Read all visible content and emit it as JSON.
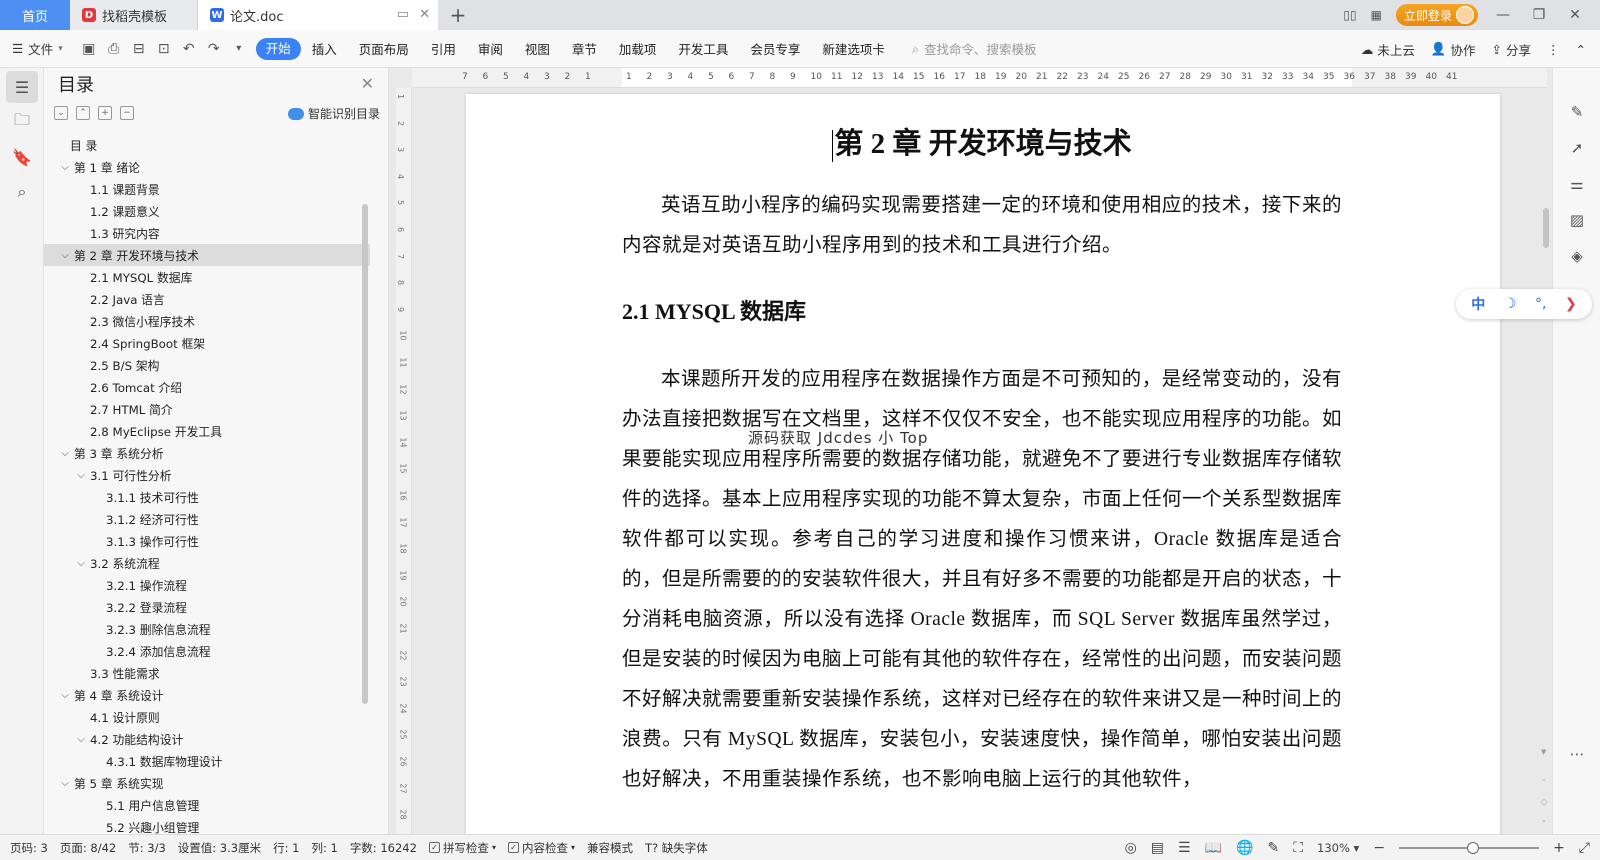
{
  "tabs": {
    "home": "首页",
    "template": "找稻壳模板",
    "doc": "论文.doc",
    "add": "+"
  },
  "titlebar": {
    "login": "立即登录"
  },
  "ribbon": {
    "file": "文件",
    "menus": [
      "开始",
      "插入",
      "页面布局",
      "引用",
      "审阅",
      "视图",
      "章节",
      "加载项",
      "开发工具",
      "会员专享",
      "新建选项卡"
    ],
    "active_menu": "开始",
    "search_placeholder": "查找命令、搜索模板",
    "cloud": "未上云",
    "collab": "协作",
    "share": "分享"
  },
  "outline": {
    "title": "目录",
    "smart": "智能识别目录",
    "items": [
      {
        "label": "目  录",
        "level": 0,
        "chev": ""
      },
      {
        "label": "第 1 章  绪论",
        "level": 1,
        "chev": "v"
      },
      {
        "label": "1.1  课题背景",
        "level": 2,
        "chev": ""
      },
      {
        "label": "1.2  课题意义",
        "level": 2,
        "chev": ""
      },
      {
        "label": "1.3  研究内容",
        "level": 2,
        "chev": ""
      },
      {
        "label": "第 2 章  开发环境与技术",
        "level": 1,
        "chev": "v",
        "active": true
      },
      {
        "label": "2.1 MYSQL 数据库",
        "level": 2,
        "chev": ""
      },
      {
        "label": "2.2 Java 语言",
        "level": 2,
        "chev": ""
      },
      {
        "label": "2.3  微信小程序技术",
        "level": 2,
        "chev": ""
      },
      {
        "label": "2.4 SpringBoot 框架",
        "level": 2,
        "chev": ""
      },
      {
        "label": "2.5 B/S 架构",
        "level": 2,
        "chev": ""
      },
      {
        "label": "2.6 Tomcat  介绍",
        "level": 2,
        "chev": ""
      },
      {
        "label": "2.7 HTML 简介",
        "level": 2,
        "chev": ""
      },
      {
        "label": "2.8 MyEclipse 开发工具",
        "level": 2,
        "chev": ""
      },
      {
        "label": "第 3 章  系统分析",
        "level": 1,
        "chev": "v"
      },
      {
        "label": "3.1  可行性分析",
        "level": "2c",
        "chev": "v"
      },
      {
        "label": "3.1.1  技术可行性",
        "level": 3,
        "chev": ""
      },
      {
        "label": "3.1.2  经济可行性",
        "level": 3,
        "chev": ""
      },
      {
        "label": "3.1.3  操作可行性",
        "level": 3,
        "chev": ""
      },
      {
        "label": "3.2  系统流程",
        "level": "2c",
        "chev": "v"
      },
      {
        "label": "3.2.1  操作流程",
        "level": 3,
        "chev": ""
      },
      {
        "label": "3.2.2  登录流程",
        "level": 3,
        "chev": ""
      },
      {
        "label": "3.2.3  删除信息流程",
        "level": 3,
        "chev": ""
      },
      {
        "label": "3.2.4  添加信息流程",
        "level": 3,
        "chev": ""
      },
      {
        "label": "3.3  性能需求",
        "level": 2,
        "chev": ""
      },
      {
        "label": "第 4 章  系统设计",
        "level": 1,
        "chev": "v"
      },
      {
        "label": "4.1  设计原则",
        "level": 2,
        "chev": ""
      },
      {
        "label": "4.2  功能结构设计",
        "level": "2c",
        "chev": "v"
      },
      {
        "label": "4.3.1  数据库物理设计",
        "level": 3,
        "chev": ""
      },
      {
        "label": "第 5 章  系统实现",
        "level": 1,
        "chev": "v"
      },
      {
        "label": "5.1 用户信息管理",
        "level": 3,
        "chev": ""
      },
      {
        "label": "5.2 兴趣小组管理",
        "level": 3,
        "chev": ""
      }
    ]
  },
  "ruler": {
    "h_numbers": [
      "7",
      "6",
      "5",
      "4",
      "3",
      "2",
      "1",
      "",
      "1",
      "2",
      "3",
      "4",
      "5",
      "6",
      "7",
      "8",
      "9",
      "10",
      "11",
      "12",
      "13",
      "14",
      "15",
      "16",
      "17",
      "18",
      "19",
      "20",
      "21",
      "22",
      "23",
      "24",
      "25",
      "26",
      "27",
      "28",
      "29",
      "30",
      "31",
      "32",
      "33",
      "34",
      "35",
      "36",
      "37",
      "38",
      "39",
      "40",
      "41"
    ],
    "v_numbers": [
      "1",
      "2",
      "3",
      "4",
      "5",
      "6",
      "7",
      "8",
      "9",
      "10",
      "11",
      "12",
      "13",
      "14",
      "15",
      "16",
      "17",
      "18",
      "19",
      "20",
      "21",
      "22",
      "23",
      "24",
      "25",
      "26",
      "27",
      "28"
    ]
  },
  "document": {
    "chapter_title": "第 2 章  开发环境与技术",
    "intro": "英语互助小程序的编码实现需要搭建一定的环境和使用相应的技术，接下来的内容就是对英语互助小程序用到的技术和工具进行介绍。",
    "section_title": "2.1 MYSQL 数据库",
    "body": "本课题所开发的应用程序在数据操作方面是不可预知的，是经常变动的，没有办法直接把数据写在文档里，这样不仅仅不安全，也不能实现应用程序的功能。如果要能实现应用程序所需要的数据存储功能，就避免不了要进行专业数据库存储软件的选择。基本上应用程序实现的功能不算太复杂，市面上任何一个关系型数据库软件都可以实现。参考自己的学习进度和操作习惯来讲，Oracle 数据库是适合的，但是所需要的的安装软件很大，并且有好多不需要的功能都是开启的状态，十分消耗电脑资源，所以没有选择 Oracle 数据库，而 SQL Server 数据库虽然学过，但是安装的时候因为电脑上可能有其他的软件存在，经常性的出问题，而安装问题不好解决就需要重新安装操作系统，这样对已经存在的软件来讲又是一种时间上的浪费。只有 MySQL 数据库，安装包小，安装速度快，操作简单，哪怕安装出问题也好解决，不用重装操作系统，也不影响电脑上运行的其他软件，",
    "watermark": "源码获取 Jdcdes 小 Top"
  },
  "ime": {
    "lang": "中"
  },
  "status": {
    "page_code": "页码: 3",
    "page": "页面: 8/42",
    "section": "节: 3/3",
    "setting": "设置值: 3.3厘米",
    "row": "行: 1",
    "col": "列: 1",
    "words": "字数: 16242",
    "spell": "拼写检查",
    "content": "内容检查",
    "compat": "兼容模式",
    "missing_font": "缺失字体",
    "zoom": "130%"
  }
}
